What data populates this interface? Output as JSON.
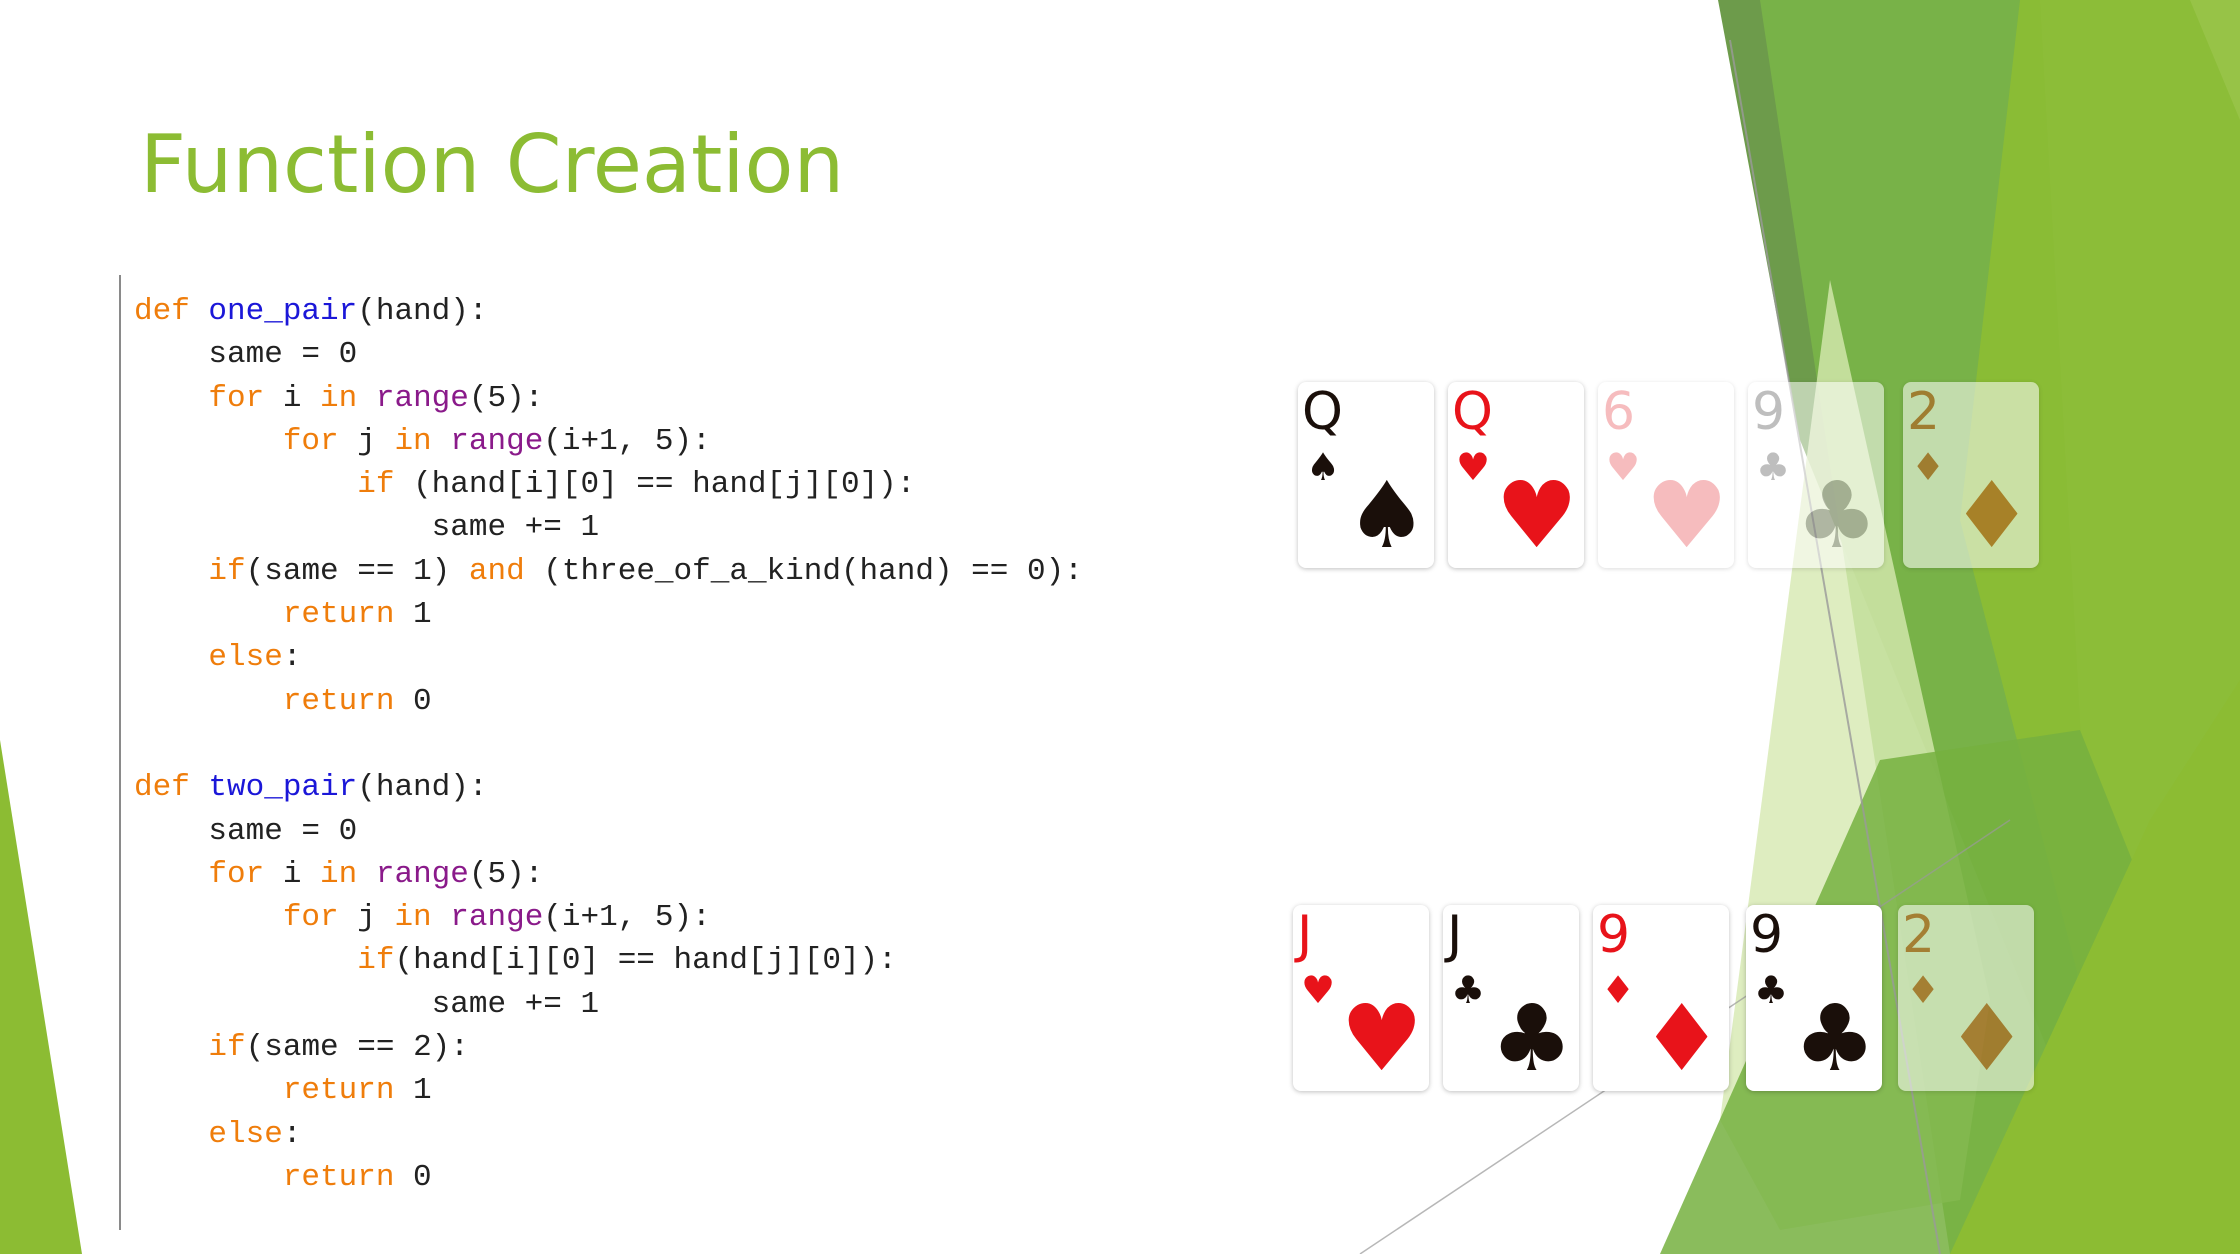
{
  "slide": {
    "title": "Function Creation",
    "colors": {
      "title": "#8cbc33",
      "keyword": "#ef7d0b",
      "function_name": "#1b17d8",
      "builtin": "#8a1a8a",
      "green_light": "#9ac73d",
      "green_dark": "#548a2c"
    }
  },
  "code": {
    "lines": [
      [
        {
          "t": "def",
          "c": "kw"
        },
        {
          "t": " ",
          "c": "op"
        },
        {
          "t": "one_pair",
          "c": "fn"
        },
        {
          "t": "(hand):",
          "c": "op"
        }
      ],
      [
        {
          "t": "    same = 0",
          "c": "op"
        }
      ],
      [
        {
          "t": "    ",
          "c": "op"
        },
        {
          "t": "for",
          "c": "kw"
        },
        {
          "t": " i ",
          "c": "op"
        },
        {
          "t": "in",
          "c": "kw"
        },
        {
          "t": " ",
          "c": "op"
        },
        {
          "t": "range",
          "c": "bi"
        },
        {
          "t": "(5):",
          "c": "op"
        }
      ],
      [
        {
          "t": "        ",
          "c": "op"
        },
        {
          "t": "for",
          "c": "kw"
        },
        {
          "t": " j ",
          "c": "op"
        },
        {
          "t": "in",
          "c": "kw"
        },
        {
          "t": " ",
          "c": "op"
        },
        {
          "t": "range",
          "c": "bi"
        },
        {
          "t": "(i+1, 5):",
          "c": "op"
        }
      ],
      [
        {
          "t": "            ",
          "c": "op"
        },
        {
          "t": "if",
          "c": "kw"
        },
        {
          "t": " (hand[i][0] == hand[j][0]):",
          "c": "op"
        }
      ],
      [
        {
          "t": "                same += 1",
          "c": "op"
        }
      ],
      [
        {
          "t": "    ",
          "c": "op"
        },
        {
          "t": "if",
          "c": "kw"
        },
        {
          "t": "(same == 1) ",
          "c": "op"
        },
        {
          "t": "and",
          "c": "kw"
        },
        {
          "t": " (three_of_a_kind(hand) == 0):",
          "c": "op"
        }
      ],
      [
        {
          "t": "        ",
          "c": "op"
        },
        {
          "t": "return",
          "c": "kw"
        },
        {
          "t": " 1",
          "c": "op"
        }
      ],
      [
        {
          "t": "    ",
          "c": "op"
        },
        {
          "t": "else",
          "c": "kw"
        },
        {
          "t": ":",
          "c": "op"
        }
      ],
      [
        {
          "t": "        ",
          "c": "op"
        },
        {
          "t": "return",
          "c": "kw"
        },
        {
          "t": " 0",
          "c": "op"
        }
      ],
      [],
      [
        {
          "t": "def",
          "c": "kw"
        },
        {
          "t": " ",
          "c": "op"
        },
        {
          "t": "two_pair",
          "c": "fn"
        },
        {
          "t": "(hand):",
          "c": "op"
        }
      ],
      [
        {
          "t": "    same = 0",
          "c": "op"
        }
      ],
      [
        {
          "t": "    ",
          "c": "op"
        },
        {
          "t": "for",
          "c": "kw"
        },
        {
          "t": " i ",
          "c": "op"
        },
        {
          "t": "in",
          "c": "kw"
        },
        {
          "t": " ",
          "c": "op"
        },
        {
          "t": "range",
          "c": "bi"
        },
        {
          "t": "(5):",
          "c": "op"
        }
      ],
      [
        {
          "t": "        ",
          "c": "op"
        },
        {
          "t": "for",
          "c": "kw"
        },
        {
          "t": " j ",
          "c": "op"
        },
        {
          "t": "in",
          "c": "kw"
        },
        {
          "t": " ",
          "c": "op"
        },
        {
          "t": "range",
          "c": "bi"
        },
        {
          "t": "(i+1, 5):",
          "c": "op"
        }
      ],
      [
        {
          "t": "            ",
          "c": "op"
        },
        {
          "t": "if",
          "c": "kw"
        },
        {
          "t": "(hand[i][0] == hand[j][0]):",
          "c": "op"
        }
      ],
      [
        {
          "t": "                same += 1",
          "c": "op"
        }
      ],
      [
        {
          "t": "    ",
          "c": "op"
        },
        {
          "t": "if",
          "c": "kw"
        },
        {
          "t": "(same == 2):",
          "c": "op"
        }
      ],
      [
        {
          "t": "        ",
          "c": "op"
        },
        {
          "t": "return",
          "c": "kw"
        },
        {
          "t": " 1",
          "c": "op"
        }
      ],
      [
        {
          "t": "    ",
          "c": "op"
        },
        {
          "t": "else",
          "c": "kw"
        },
        {
          "t": ":",
          "c": "op"
        }
      ],
      [
        {
          "t": "        ",
          "c": "op"
        },
        {
          "t": "return",
          "c": "kw"
        },
        {
          "t": " 0",
          "c": "op"
        }
      ]
    ]
  },
  "hands": [
    {
      "cards": [
        {
          "rank": "Q",
          "suit": "spade",
          "symbol": "♠",
          "color": "black",
          "faded": false
        },
        {
          "rank": "Q",
          "suit": "heart",
          "symbol": "♥",
          "color": "red",
          "faded": false
        },
        {
          "rank": "6",
          "suit": "heart",
          "symbol": "♥",
          "color": "pink",
          "faded": true
        },
        {
          "rank": "9",
          "suit": "club",
          "symbol": "♣",
          "color": "grey",
          "faded": true
        },
        {
          "rank": "2",
          "suit": "diamond",
          "symbol": "♦",
          "color": "brown",
          "faded": true
        }
      ]
    },
    {
      "cards": [
        {
          "rank": "J",
          "suit": "heart",
          "symbol": "♥",
          "color": "red",
          "faded": false
        },
        {
          "rank": "J",
          "suit": "club",
          "symbol": "♣",
          "color": "black",
          "faded": false
        },
        {
          "rank": "9",
          "suit": "diamond",
          "symbol": "♦",
          "color": "red",
          "faded": false
        },
        {
          "rank": "9",
          "suit": "club",
          "symbol": "♣",
          "color": "black",
          "faded": false
        },
        {
          "rank": "2",
          "suit": "diamond",
          "symbol": "♦",
          "color": "brown",
          "faded": true
        }
      ]
    }
  ]
}
